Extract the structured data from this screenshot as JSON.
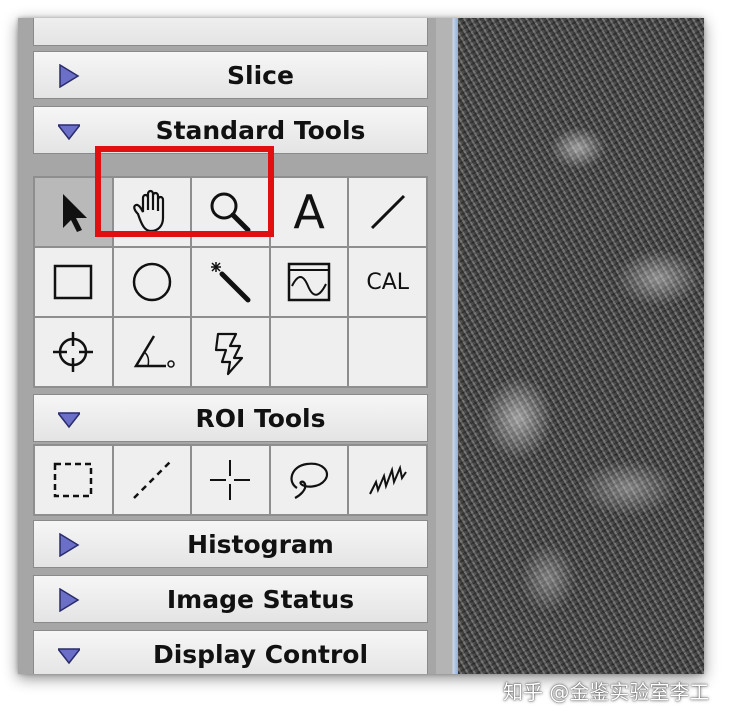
{
  "panels": {
    "slice": {
      "label": "Slice",
      "state": "collapsed"
    },
    "standard_tools": {
      "label": "Standard Tools",
      "state": "expanded"
    },
    "roi_tools": {
      "label": "ROI Tools",
      "state": "expanded"
    },
    "histogram": {
      "label": "Histogram",
      "state": "collapsed"
    },
    "image_status": {
      "label": "Image Status",
      "state": "collapsed"
    },
    "display_control": {
      "label": "Display Control",
      "state": "expanded"
    }
  },
  "standard_tools": {
    "text_tool_glyph": "A",
    "calibrate_glyph": "CAL",
    "items": [
      {
        "icon": "arrow-pointer-icon",
        "selected": true
      },
      {
        "icon": "hand-icon",
        "highlighted": true
      },
      {
        "icon": "magnifier-icon",
        "highlighted": true
      },
      {
        "icon": "text-tool-icon"
      },
      {
        "icon": "line-tool-icon"
      },
      {
        "icon": "rectangle-tool-icon"
      },
      {
        "icon": "oval-tool-icon"
      },
      {
        "icon": "magic-wand-icon"
      },
      {
        "icon": "profile-tool-icon"
      },
      {
        "icon": "calibrate-icon"
      },
      {
        "icon": "crosshair-icon"
      },
      {
        "icon": "angle-tool-icon"
      },
      {
        "icon": "lightning-icon"
      },
      {
        "icon": "empty"
      },
      {
        "icon": "empty"
      }
    ]
  },
  "roi_tools": {
    "items": [
      {
        "icon": "dashed-rectangle-icon"
      },
      {
        "icon": "dashed-line-icon"
      },
      {
        "icon": "point-roi-icon"
      },
      {
        "icon": "lasso-icon"
      },
      {
        "icon": "freehand-icon"
      }
    ]
  },
  "colors": {
    "highlight": "#e01010",
    "triangle": "#6b6fc8"
  },
  "watermark": "知乎 @金鉴实验室李工"
}
